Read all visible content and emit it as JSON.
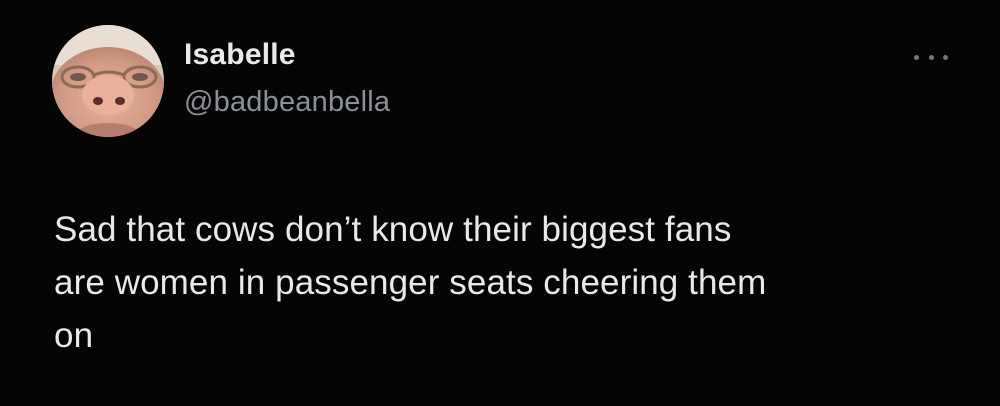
{
  "tweet": {
    "avatar_icon": "profile-photo-avatar",
    "display_name": "Isabelle",
    "handle": "@badbeanbella",
    "more_icon": "more-options-icon",
    "text_lines": [
      "Sad that cows don’t know their biggest fans",
      "are women in passenger seats cheering them",
      "on"
    ]
  },
  "colors": {
    "background": "#050505",
    "name": "#e9eaea",
    "handle": "#8b9096",
    "text": "#e7e9ea",
    "more_dots": "#6e767d"
  }
}
